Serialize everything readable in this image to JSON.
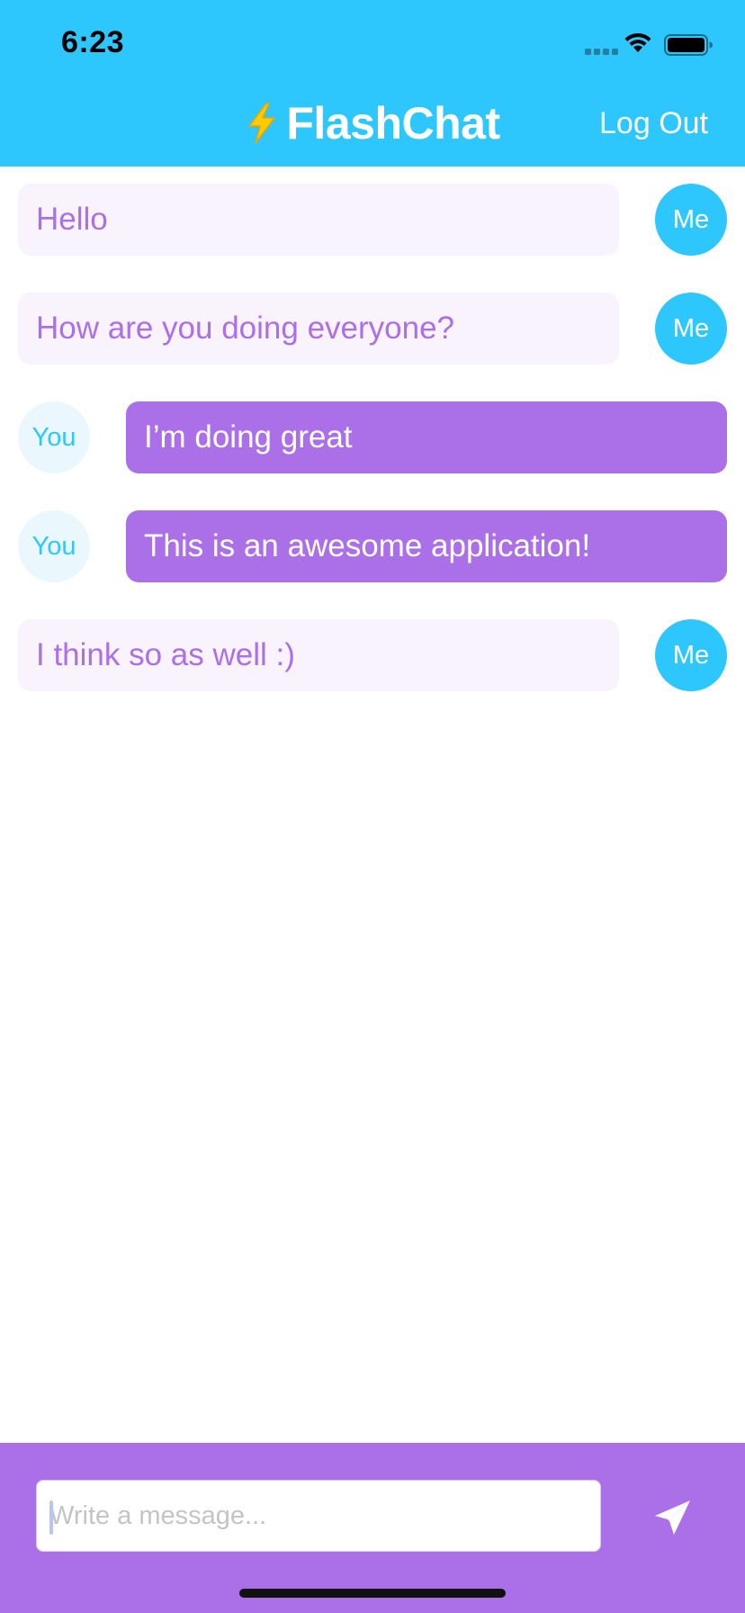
{
  "status_bar": {
    "time": "6:23"
  },
  "nav": {
    "title": "FlashChat",
    "logout_label": "Log Out"
  },
  "colors": {
    "brand_blue": "#2ec7fd",
    "brand_purple": "#ab6fe8",
    "light_purple": "#f8f3fc",
    "light_blue": "#eaf8fe"
  },
  "messages": [
    {
      "sender": "me",
      "avatar": "Me",
      "text": "Hello"
    },
    {
      "sender": "me",
      "avatar": "Me",
      "text": "How are you doing everyone?"
    },
    {
      "sender": "you",
      "avatar": "You",
      "text": "I’m doing great"
    },
    {
      "sender": "you",
      "avatar": "You",
      "text": "This is an awesome application!"
    },
    {
      "sender": "me",
      "avatar": "Me",
      "text": "I think so as well :)"
    }
  ],
  "composer": {
    "placeholder": "Write a message...",
    "value": "",
    "send_icon": "paper-plane-icon"
  }
}
